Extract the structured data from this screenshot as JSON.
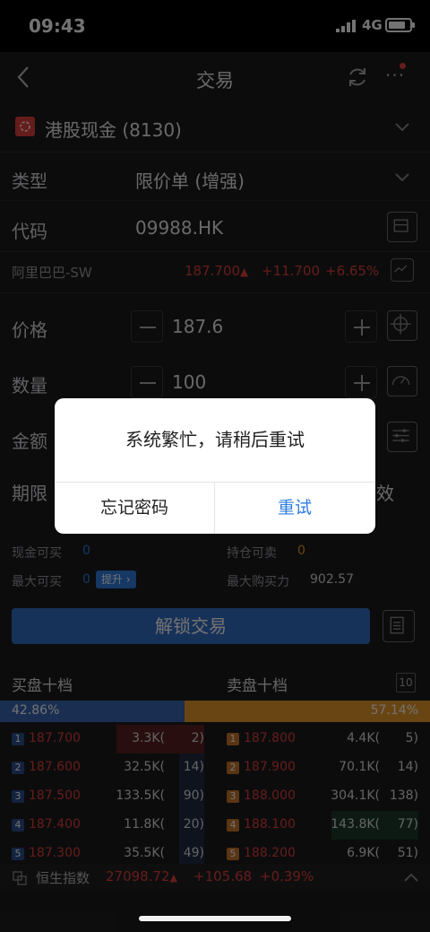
{
  "status_bar": {
    "time": "09:43",
    "network": "4G"
  },
  "nav": {
    "title": "交易"
  },
  "account": {
    "label": "港股现金 (8130)"
  },
  "form": {
    "type_label": "类型",
    "type_value": "限价单 (增强)",
    "code_label": "代码",
    "code_value": "09988.HK",
    "stock_name": "阿里巴巴-SW",
    "stock_price": "187.700",
    "stock_change": "+11.700",
    "stock_change_pct": "+6.65%",
    "price_label": "价格",
    "price_value": "187.6",
    "qty_label": "数量",
    "qty_value": "100",
    "amount_label": "金额",
    "term_label": "期限",
    "term_value_suffix": "效"
  },
  "funds": {
    "cash_buy_label": "现金可买",
    "cash_buy_value": "0",
    "hold_sell_label": "持仓可卖",
    "hold_sell_value": "0",
    "max_buy_label": "最大可买",
    "max_buy_value": "0",
    "upgrade_label": "提升",
    "max_power_label": "最大购买力",
    "max_power_value": "902.57"
  },
  "unlock_button": "解锁交易",
  "orderbook": {
    "buy_title": "买盘十档",
    "sell_title": "卖盘十档",
    "depth_badge": "10",
    "buy_pct": "42.86%",
    "sell_pct": "57.14%",
    "buy_ratio": 0.4286,
    "bids": [
      {
        "level": "1",
        "price": "187.700",
        "vol": "3.3K(",
        "cnt": "2)"
      },
      {
        "level": "2",
        "price": "187.600",
        "vol": "32.5K(",
        "cnt": "14)"
      },
      {
        "level": "3",
        "price": "187.500",
        "vol": "133.5K(",
        "cnt": "90)"
      },
      {
        "level": "4",
        "price": "187.400",
        "vol": "11.8K(",
        "cnt": "20)"
      },
      {
        "level": "5",
        "price": "187.300",
        "vol": "35.5K(",
        "cnt": "49)"
      }
    ],
    "asks": [
      {
        "level": "1",
        "price": "187.800",
        "vol": "4.4K(",
        "cnt": "5)"
      },
      {
        "level": "2",
        "price": "187.900",
        "vol": "70.1K(",
        "cnt": "14)"
      },
      {
        "level": "3",
        "price": "188.000",
        "vol": "304.1K(",
        "cnt": "138)"
      },
      {
        "level": "4",
        "price": "188.100",
        "vol": "143.8K(",
        "cnt": "77)"
      },
      {
        "level": "5",
        "price": "188.200",
        "vol": "6.9K(",
        "cnt": "51)"
      }
    ]
  },
  "index_bar": {
    "name": "恒生指数",
    "value": "27098.72",
    "change": "+105.68",
    "change_pct": "+0.39%"
  },
  "dialog": {
    "message": "系统繁忙，请稍后重试",
    "forgot_label": "忘记密码",
    "retry_label": "重试"
  },
  "colors": {
    "up": "#e0403c",
    "accent": "#2f7de1",
    "sell": "#e89a2a"
  }
}
